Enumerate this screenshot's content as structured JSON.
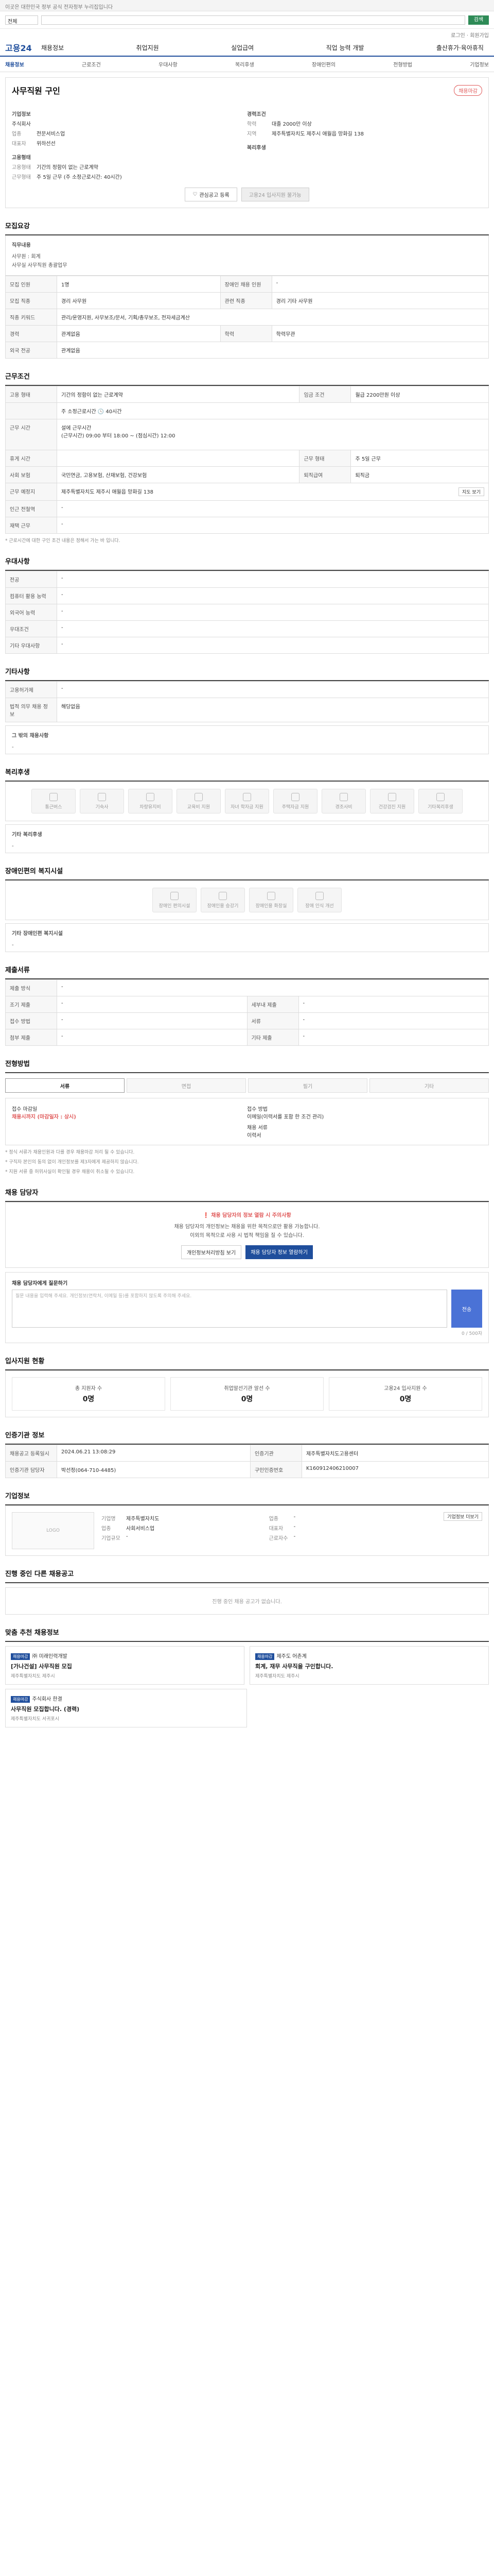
{
  "topbar": {
    "notice": "이곳은 대한민국 정부 공식 전자정부 누리집입니다"
  },
  "search": {
    "scope": "전체",
    "go": "검색"
  },
  "util": {
    "text": "로그인 · 회원가입"
  },
  "header": {
    "logo": "고용24",
    "menu": [
      "채용정보",
      "취업지원",
      "실업급여",
      "직업 능력 개발",
      "출산휴가·육아휴직"
    ]
  },
  "subnav": [
    "채용정보",
    "근로조건",
    "우대사항",
    "복리후생",
    "장애인편의",
    "전형방법",
    "기업정보"
  ],
  "job": {
    "title": "사무직원 구인",
    "badge": "채용마감",
    "company_label": "기업정보",
    "company_name": "주식회사",
    "company_fields": [
      {
        "k": "업종",
        "v": "전문서비스업"
      },
      {
        "k": "대표자",
        "v": "위하선선"
      }
    ],
    "career_label": "경력조건",
    "career_fields": [
      {
        "k": "학력",
        "v": "대졸 2000만 이상"
      },
      {
        "k": "지역",
        "v": "제주특별자치도 제주시 애월읍 망화길 138"
      }
    ],
    "employ_label": "고용형태",
    "employ_fields": [
      {
        "k": "고용형태",
        "v": "기간의 정함이 없는 근로계약"
      },
      {
        "k": "근무형태",
        "v": "주 5일 근무 (주 소정근로시간: 40시간)"
      }
    ],
    "welfare_label": "복리후생",
    "fav_btn": "관심공고 등록",
    "share_btn": "고용24 입사지원 불가능"
  },
  "recruit": {
    "title": "모집요강",
    "duty_label": "직무내용",
    "duty_text": "사무원 : 회계 \n사무실 사무직원 총괄업무",
    "rows": [
      {
        "k": "모집 인원",
        "v": "1명",
        "k2": "장애인 채용 인원",
        "v2": "-"
      },
      {
        "k": "모집 직종",
        "v": "경리 사무원",
        "k2": "관련 직종",
        "v2": "경리 기타 사무원"
      },
      {
        "k": "직종 키워드",
        "v": "관리/운영지원, 사무보조/문서, 기획/총무보조, 전자세금계산",
        "k2": "",
        "v2": ""
      },
      {
        "k": "경력",
        "v": "관계없음",
        "k2": "학력",
        "v2": "학력무관"
      },
      {
        "k": "외국 전공",
        "v": "관계없음",
        "k2": "",
        "v2": ""
      }
    ]
  },
  "work": {
    "title": "근무조건",
    "rows": [
      {
        "k": "고용 형태",
        "v": "기간의 정함이 없는 근로계약",
        "k2": "임금 조건",
        "v2": "월급 2200만원 이상"
      },
      {
        "k": "",
        "v": "주 소정근로시간 🕓 40시간",
        "k2": "",
        "v2": ""
      },
      {
        "k": "근무 시간",
        "v": "설에 근무시간\n(근무시간) 09:00 부터 18:00 ~ (점심시간) 12:00",
        "k2": "",
        "v2": ""
      },
      {
        "k": "휴게 시간",
        "v": "",
        "k2": "근무 형태",
        "v2": "주 5일 근무"
      },
      {
        "k": "사회 보험",
        "v": "국민연금, 고용보험, 산재보험, 건강보험",
        "k2": "퇴직급여",
        "v2": "퇴직금"
      },
      {
        "k": "근무 예정지",
        "v": "제주특별자치도 제주시 애월읍 망화길 138",
        "k2": "",
        "v2": ""
      },
      {
        "k": "인근 전철역",
        "v": "-",
        "k2": "",
        "v2": ""
      },
      {
        "k": "재택 근무",
        "v": "-",
        "k2": "",
        "v2": ""
      }
    ],
    "map_btn": "지도 보기",
    "note": "* 근로시간에 대한 구인 조건 내용은 정해서 가는 바 입니다."
  },
  "pref": {
    "title": "우대사항",
    "rows": [
      {
        "k": "전공",
        "v": "-"
      },
      {
        "k": "컴퓨터 활용 능력",
        "v": "-"
      },
      {
        "k": "외국어 능력",
        "v": "-"
      },
      {
        "k": "우대조건",
        "v": "-"
      },
      {
        "k": "기타 우대사항",
        "v": "-"
      }
    ]
  },
  "etc": {
    "title": "기타사항",
    "rows": [
      {
        "k": "고용허가제",
        "v": "-"
      },
      {
        "k": "법적 의무 채용 정보",
        "v": "해당없음"
      }
    ],
    "detail_label": "그 밖의 채용사항",
    "detail": "-"
  },
  "welfare": {
    "title": "복리후생",
    "items": [
      "통근버스",
      "기숙사",
      "차량유지비",
      "교육비 지원",
      "자녀 학자금 지원",
      "주택자금 지원",
      "경조사비",
      "건강검진 지원",
      "기타복리후생"
    ],
    "other_label": "기타 복리후생",
    "other": "-"
  },
  "disability": {
    "title": "장애인편의 복지시설",
    "items": [
      "장애인 편의시설",
      "장애인용 승강기",
      "장애인용 화장실",
      "장애 인식 개선"
    ],
    "detail_label": "기타 장애인편 복지시설",
    "detail": "-"
  },
  "docs": {
    "title": "제출서류",
    "rows": [
      {
        "k": "제출 방식",
        "v": "-",
        "k2": "",
        "v2": ""
      },
      {
        "k": "조기 제출",
        "v": "-",
        "k2": "세부내 제출",
        "v2": "-"
      },
      {
        "k": "접수 방법",
        "v": "-",
        "k2": "서류",
        "v2": "-"
      },
      {
        "k": "첨부 제출",
        "v": "-",
        "k2": "기타 제출",
        "v2": "-"
      }
    ]
  },
  "process": {
    "title": "전형방법",
    "steps": [
      "서류",
      "면접",
      "필기",
      "기타"
    ],
    "period_label": "접수 마감일",
    "period": "채용시까지 (마감일자 : 상시)",
    "method_label": "접수 방법",
    "method": "이메일(이력서를 포함 한 조건 관리)",
    "result_label": "채용 서류",
    "result": "이력서",
    "notes": [
      "* 정식 서류가 채용인원과 다를 경우 채용마감 처리 될 수 있습니다.",
      "* 구직자 본인의 동의 없이 개인정보를 제3자에게 제공하지 않습니다.",
      "* 지원 서류 중 허위사실이 확인될 경우 채용이 취소될 수 있습니다."
    ]
  },
  "contact": {
    "title": "채용 담당자",
    "warn_head": "채용 담당자의 정보 열람 시 주의사항",
    "warn_body": "채용 담당자의 개인정보는 채용을 위한 목적으로만 활용 가능합니다.\n이외의 목적으로 사용 시 법적 책임을 질 수 있습니다.",
    "btn1": "개인정보처리방침 보기",
    "btn2": "채용 담당자 정보 열람하기",
    "qna_label": "채용 담당자에게 질문하기",
    "qna_placeholder": "질문 내용을 입력해 주세요. 개인정보(연락처, 이메일 등)를 포함하지 않도록 주의해 주세요.",
    "qna_count": "0 / 500자",
    "send": "전송"
  },
  "stats": {
    "title": "입사지원 현황",
    "items": [
      {
        "label": "총 지원자 수",
        "value": "0명"
      },
      {
        "label": "취업알선기관 알선 수",
        "value": "0명"
      },
      {
        "label": "고용24 입사지원 수",
        "value": "0명"
      }
    ]
  },
  "manage": {
    "title": "인증기관 정보",
    "rows": [
      {
        "k": "채용공고 등록일시",
        "v": "2024.06.21 13:08:29",
        "k2": "인증기관",
        "v2": "제주특별자치도고용센터"
      },
      {
        "k": "인증기관 담당자",
        "v": "박선정(064-710-4485)",
        "k2": "구인인증번호",
        "v2": "K160912406210007"
      }
    ]
  },
  "companyinfo": {
    "title": "기업정보",
    "logo_alt": "LOGO",
    "fields": [
      {
        "k": "기업명",
        "v": "제주특별자치도",
        "k2": "업종",
        "v2": "-"
      },
      {
        "k": "업종",
        "v": "사회서비스업",
        "k2": "대표자",
        "v2": "-"
      },
      {
        "k": "기업규모",
        "v": "-",
        "k2": "근로자수",
        "v2": "-"
      }
    ],
    "more_btn": "기업정보 더보기"
  },
  "similar": {
    "title": "진행 중인 다른 채용공고",
    "empty": "진행 중인 채용 공고가 없습니다."
  },
  "recommend": {
    "title": "맞춤 추천 채용정보",
    "items": [
      {
        "tag": "채용마감",
        "company": "㈜ 미래인력개발",
        "name": "[가나건설] 사무직원 모집",
        "sub": "제주특별자치도 제주시"
      },
      {
        "tag": "채용마감",
        "company": "제주도 어촌계",
        "name": "회계, 재무 사무직을 구인합니다.",
        "sub": "제주특별자치도 제주시"
      },
      {
        "tag": "채용마감",
        "company": "주식회사 한결",
        "name": "사무직원 모집합니다. (경력)",
        "sub": "제주특별자치도 서귀포시"
      }
    ]
  }
}
